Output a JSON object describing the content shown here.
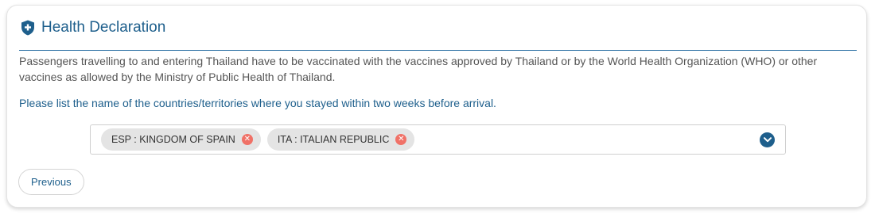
{
  "section": {
    "title": "Health Declaration",
    "icon": "shield-plus-icon",
    "accent_color": "#1e5f8c"
  },
  "description": "Passengers travelling to and entering Thailand have to be vaccinated with the vaccines approved by Thailand or by the World Health Organization (WHO) or other vaccines as allowed by the Ministry of Public Health of Thailand.",
  "instruction": "Please list the name of the countries/territories where you stayed within two weeks before arrival.",
  "countries": {
    "selected": [
      {
        "label": "ESP : KINGDOM OF SPAIN"
      },
      {
        "label": "ITA : ITALIAN REPUBLIC"
      }
    ],
    "remove_icon": "close-circle-icon",
    "dropdown_icon": "chevron-down-circle-icon"
  },
  "nav": {
    "previous_label": "Previous"
  }
}
